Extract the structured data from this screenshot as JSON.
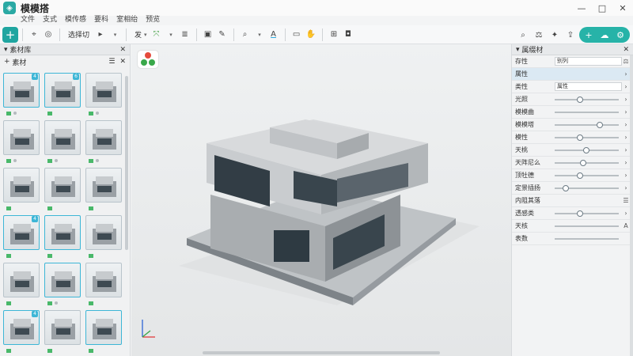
{
  "app": {
    "title": "模模搭"
  },
  "window": {
    "minimize": "—",
    "maximize": "□",
    "close": "✕"
  },
  "menu": [
    "文件",
    "支式",
    "模传感",
    "要科",
    "室相绐",
    "预览"
  ],
  "toolbar": {
    "add": "+",
    "select_label": "选择切",
    "tool_a_label": "发",
    "icons": [
      "cursor-icon",
      "target-icon",
      "play-icon",
      "link-icon",
      "layers-icon",
      "box-icon",
      "edit-icon",
      "search-icon",
      "text-color-icon",
      "monitor-icon",
      "hand-icon",
      "grid-icon",
      "camera-icon"
    ],
    "right_icons": [
      "search-icon",
      "scale-icon",
      "paint-icon",
      "share-icon"
    ]
  },
  "left_panel": {
    "title": "素材库",
    "subtitle": "素材",
    "thumbnail_badges": [
      "4",
      "6",
      "4",
      "4"
    ],
    "rows": 6
  },
  "right_panel": {
    "title": "属缀材",
    "name_label": "存性",
    "name_value": "别列",
    "section_attr": "属性",
    "type_label": "类性",
    "type_value": "属性",
    "properties": [
      {
        "label": "光照",
        "level": 0.35
      },
      {
        "label": "模模曲",
        "level": 0.0
      },
      {
        "label": "模模塔",
        "level": 0.65
      },
      {
        "label": "模性",
        "level": 0.35
      },
      {
        "label": "天桃",
        "level": 0.45
      },
      {
        "label": "天阵尼么",
        "level": 0.4
      },
      {
        "label": "顶牡德",
        "level": 0.35
      },
      {
        "label": "定景插扬",
        "level": 0.12
      }
    ],
    "section_2": "内阻其落",
    "properties_2": [
      {
        "label": "透感类",
        "level": 0.35
      },
      {
        "label": "天核",
        "value": "A"
      },
      {
        "label": "表数",
        "value": ""
      }
    ]
  },
  "colors": {
    "accent": "#1fa5a0",
    "selection": "#3db6d6",
    "highlight_row": "#dbe9f3"
  }
}
